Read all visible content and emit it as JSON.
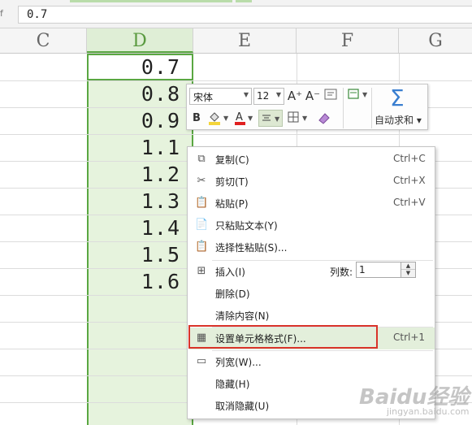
{
  "formula_bar": {
    "fx_label": "f",
    "value": "0.7"
  },
  "columns": [
    {
      "id": "col-c",
      "label": "C"
    },
    {
      "id": "col-d",
      "label": "D"
    },
    {
      "id": "col-e",
      "label": "E"
    },
    {
      "id": "col-f",
      "label": "F"
    },
    {
      "id": "col-g",
      "label": "G"
    }
  ],
  "cells": [
    "0.7",
    "0.8",
    "0.9",
    "1.1",
    "1.2",
    "1.3",
    "1.4",
    "1.5",
    "1.6"
  ],
  "mini_toolbar": {
    "font_name": "宋体",
    "font_size": "12",
    "grow_font": "A⁺",
    "shrink_font": "A⁻",
    "bold": "B",
    "font_color_letter": "A",
    "autosum_label": "自动求和",
    "autosum_symbol": "Σ"
  },
  "context_menu": {
    "items": [
      {
        "label": "复制(C)",
        "shortcut": "Ctrl+C",
        "icon": "copy-icon"
      },
      {
        "label": "剪切(T)",
        "shortcut": "Ctrl+X",
        "icon": "scissors-icon"
      },
      {
        "label": "粘贴(P)",
        "shortcut": "Ctrl+V",
        "icon": "paste-icon"
      },
      {
        "label": "只粘贴文本(Y)",
        "shortcut": "",
        "icon": "paste-text-icon"
      },
      {
        "label": "选择性粘贴(S)...",
        "shortcut": "",
        "icon": "paste-special-icon"
      },
      {
        "label": "插入(I)",
        "shortcut": "",
        "icon": "insert-icon"
      },
      {
        "label": "删除(D)",
        "shortcut": "",
        "icon": ""
      },
      {
        "label": "清除内容(N)",
        "shortcut": "",
        "icon": ""
      },
      {
        "label": "设置单元格格式(F)...",
        "shortcut": "Ctrl+1",
        "icon": "format-cells-icon"
      },
      {
        "label": "列宽(W)...",
        "shortcut": "",
        "icon": "column-width-icon"
      },
      {
        "label": "隐藏(H)",
        "shortcut": "",
        "icon": ""
      },
      {
        "label": "取消隐藏(U)",
        "shortcut": "",
        "icon": ""
      }
    ],
    "columns_label": "列数:",
    "columns_value": "1"
  },
  "colors": {
    "accent_green": "#5aa742",
    "selected_fill": "#e6f3dd",
    "highlight_box": "#d9342a",
    "sigma_blue": "#3a7fd0"
  },
  "watermark": {
    "text": "Baidu经验",
    "sub": "jingyan.baidu.com"
  }
}
